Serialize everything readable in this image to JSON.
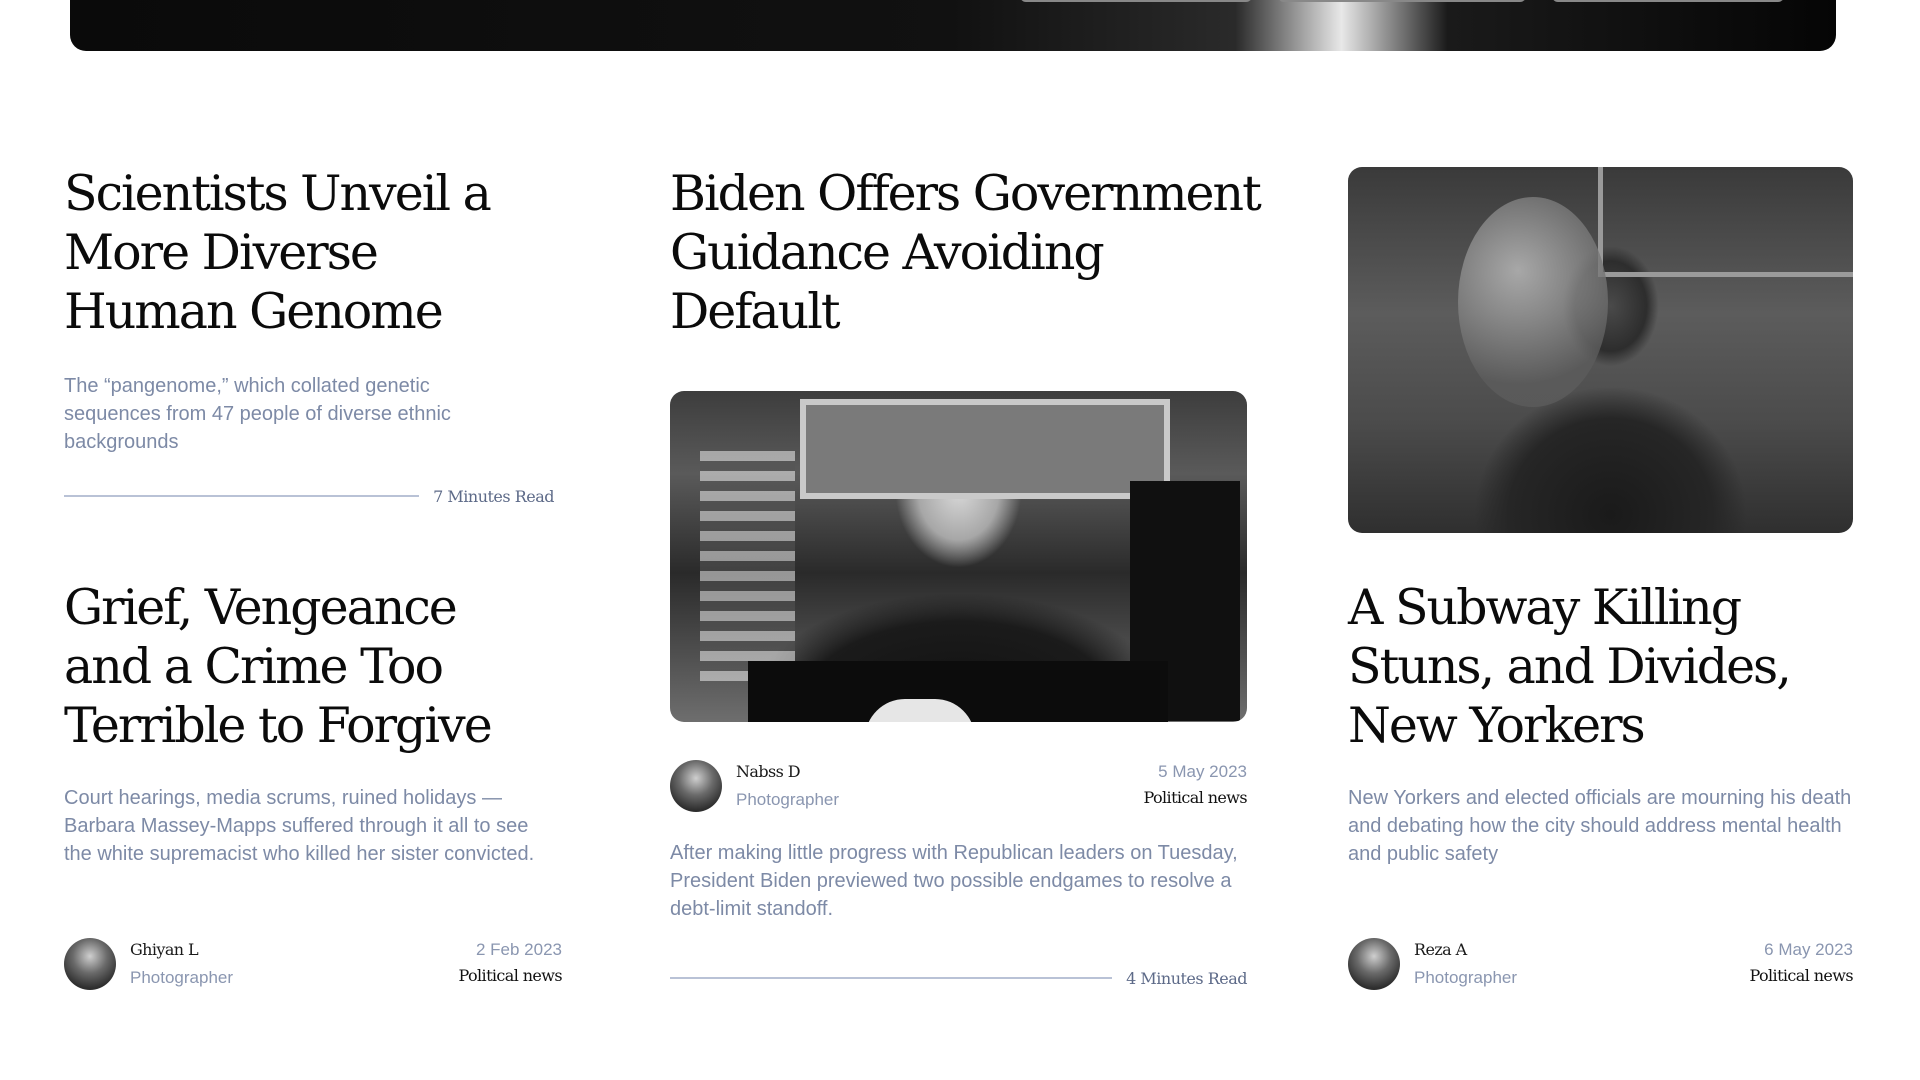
{
  "hero": {},
  "articles": {
    "genome": {
      "title": "Scientists Unveil a More Diverse Human Genome",
      "excerpt": "The “pangenome,” which collated genetic sequences from 47 people of diverse ethnic backgrounds",
      "read_time": "7 Minutes Read"
    },
    "biden": {
      "title": "Biden Offers Government Guidance Avoiding Default",
      "author": "Nabss D",
      "role": "Photographer",
      "date": "5 May 2023",
      "category": "Political news",
      "excerpt": "After making little progress with Republican leaders on Tuesday, President Biden previewed two possible endgames to resolve a debt-limit standoff.",
      "read_time": "4 Minutes Read"
    },
    "grief": {
      "title": "Grief, Vengeance and a Crime Too Terrible to Forgive",
      "excerpt": "Court hearings, media scrums, ruined holidays — Barbara Massey-Mapps suffered through it all to see the white supremacist who killed her sister convicted.",
      "author": "Ghiyan L",
      "role": "Photographer",
      "date": "2 Feb 2023",
      "category": "Political news"
    },
    "subway": {
      "title": "A Subway Killing Stuns, and Divides, New Yorkers",
      "excerpt": "New Yorkers and elected officials are mourning his death and debating how the city should address mental health and public safety",
      "author": "Reza A",
      "role": "Photographer",
      "date": "6 May 2023",
      "category": "Political news"
    }
  }
}
